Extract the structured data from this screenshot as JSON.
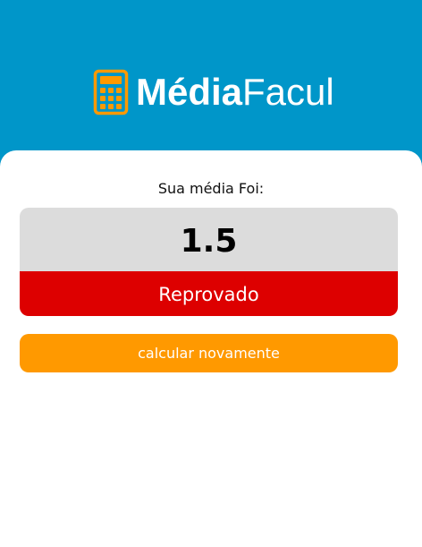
{
  "brand": {
    "name_strong": "Média",
    "name_light": "Facul",
    "icon": "calculator-icon",
    "icon_color": "#ff9900"
  },
  "colors": {
    "header_bg": "#0096c9",
    "value_bg": "#dcdcdc",
    "fail": "#dd0000",
    "button": "#ff9900"
  },
  "result": {
    "label": "Sua média Foi:",
    "value": "1.5",
    "status": "Reprovado"
  },
  "actions": {
    "recalculate_label": "calcular novamente"
  }
}
